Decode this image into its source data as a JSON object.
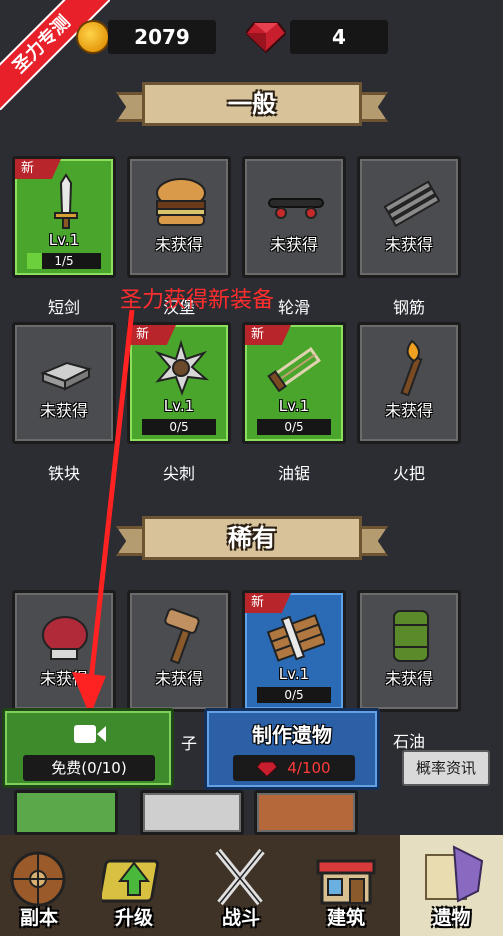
{
  "ribbon": {
    "text": "圣力专测"
  },
  "currency": {
    "coins": "2079",
    "gems": "4"
  },
  "sections": {
    "common_title": "一般",
    "rare_title": "稀有"
  },
  "common_items": [
    {
      "name": "短剑",
      "new": "新",
      "status": "Lv.1",
      "progress": "1/5",
      "progress_value": 0.2,
      "owned": true
    },
    {
      "name": "汉堡",
      "status": "未获得",
      "owned": false
    },
    {
      "name": "轮滑",
      "status": "未获得",
      "owned": false
    },
    {
      "name": "钢筋",
      "status": "未获得",
      "owned": false
    },
    {
      "name": "铁块",
      "status": "未获得",
      "owned": false
    },
    {
      "name": "尖刺",
      "new": "新",
      "status": "Lv.1",
      "progress": "0/5",
      "progress_value": 0,
      "owned": true
    },
    {
      "name": "油锯",
      "new": "新",
      "status": "Lv.1",
      "progress": "0/5",
      "progress_value": 0,
      "owned": true
    },
    {
      "name": "火把",
      "status": "未获得",
      "owned": false
    }
  ],
  "rare_items": [
    {
      "name": "",
      "status": "未获得"
    },
    {
      "name": "子",
      "status": "未获得"
    },
    {
      "name": "",
      "new": "新",
      "status": "Lv.1",
      "progress": "0/5"
    },
    {
      "name": "石油",
      "status": "未获得"
    }
  ],
  "annotation": {
    "text": "圣力获得新装备"
  },
  "free_button": {
    "label": "免费(0/10)"
  },
  "craft_button": {
    "title": "制作遗物",
    "cost": "4/100"
  },
  "probability_button": {
    "label": "概率资讯"
  },
  "nav": [
    {
      "label": "副本"
    },
    {
      "label": "升级"
    },
    {
      "label": "战斗"
    },
    {
      "label": "建筑"
    },
    {
      "label": "遗物"
    }
  ],
  "colors": {
    "accent_red": "#ff2d2d",
    "green_card": "#4aa52c",
    "blue_card": "#2b6bb5"
  }
}
